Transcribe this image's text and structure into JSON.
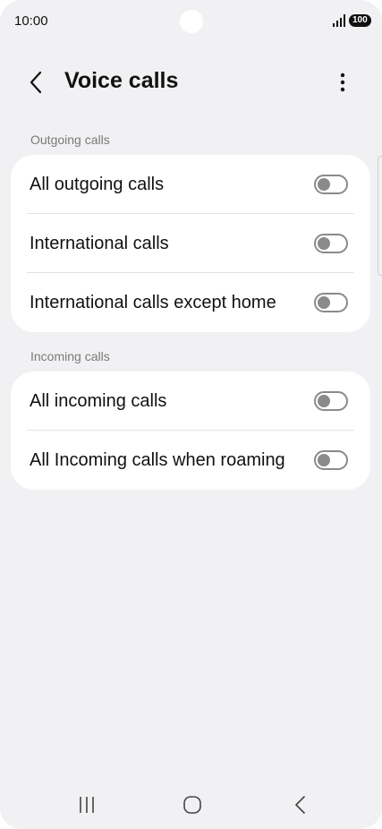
{
  "status_bar": {
    "time": "10:00",
    "battery": "100",
    "icons": [
      "camera-hole",
      "signal-icon",
      "battery-icon"
    ]
  },
  "header": {
    "title": "Voice calls",
    "icons": [
      "back-arrow-icon",
      "more-options-icon"
    ]
  },
  "sections": [
    {
      "label": "Outgoing calls",
      "items": [
        {
          "label": "All outgoing calls",
          "enabled": false
        },
        {
          "label": "International calls",
          "enabled": false
        },
        {
          "label": "International calls except home",
          "enabled": false
        }
      ]
    },
    {
      "label": "Incoming calls",
      "items": [
        {
          "label": "All incoming calls",
          "enabled": false
        },
        {
          "label": "All Incoming calls when roaming",
          "enabled": false
        }
      ]
    }
  ],
  "nav_bar": {
    "icons": [
      "recent-apps-icon",
      "home-icon",
      "back-icon"
    ]
  },
  "colors": {
    "background": "#f1f1f3",
    "card": "#ffffff",
    "toggle_off": "#8a8a8a",
    "section_label": "#7a7a7a"
  }
}
